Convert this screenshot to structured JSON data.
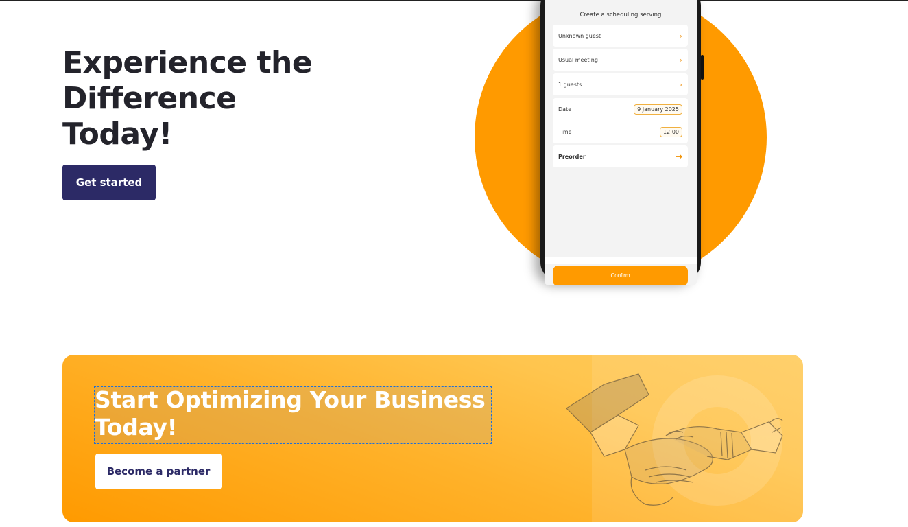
{
  "hero": {
    "title": "Experience the Difference Today!",
    "cta_label": "Get started"
  },
  "phone": {
    "screen_title": "Create a scheduling serving",
    "rows": [
      {
        "label": "Unknown guest"
      },
      {
        "label": "Usual meeting"
      },
      {
        "label": "1 guests"
      }
    ],
    "date_label": "Date",
    "date_value": "9 January 2025",
    "time_label": "Time",
    "time_value": "12:00",
    "preorder_label": "Preorder",
    "confirm_label": "Confirm"
  },
  "banner": {
    "title": "Start Optimizing Your Business Today!",
    "cta_label": "Become a partner"
  },
  "colors": {
    "accent_orange": "#ff9a00",
    "navy": "#2c2a66",
    "selection_outline": "#1f6fd6"
  },
  "icons": [
    "chevron-right-icon",
    "arrow-right-icon",
    "handshake-illustration"
  ]
}
